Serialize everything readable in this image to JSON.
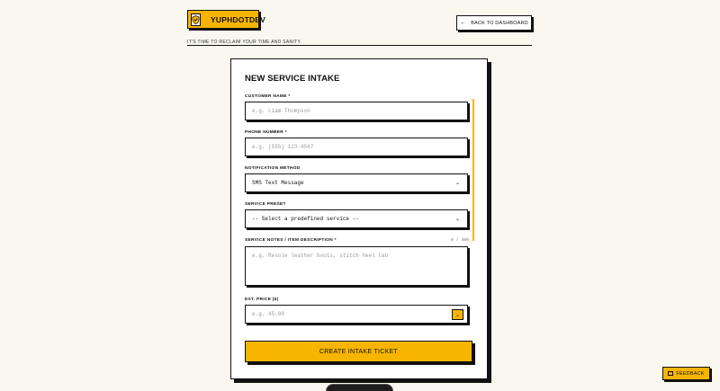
{
  "header": {
    "brand_name": "YUPHDOTDEV",
    "tagline": "IT'S TIME TO RECLAIM YOUR TIME AND SANITY.",
    "back_button": "BACK TO DASHBOARD"
  },
  "form": {
    "title": "NEW SERVICE INTAKE",
    "customer_name": {
      "label": "CUSTOMER NAME *",
      "placeholder": "e.g. Liam Thompson"
    },
    "phone": {
      "label": "PHONE NUMBER *",
      "placeholder": "e.g. (555) 123-4567"
    },
    "notification": {
      "label": "NOTIFICATION METHOD",
      "value": "SMS Text Message"
    },
    "preset": {
      "label": "SERVICE PRESET",
      "value": "-- Select a predefined service --"
    },
    "notes": {
      "label": "SERVICE NOTES / ITEM DESCRIPTION *",
      "counter": "0 / 300",
      "placeholder": "e.g. Resole leather boots, stitch heel tab"
    },
    "price": {
      "label": "EST. PRICE ($)",
      "placeholder": "e.g. 45.00"
    },
    "submit_label": "CREATE INTAKE TICKET"
  },
  "feedback_label": "FEEDBACK",
  "colors": {
    "accent": "#f7b500",
    "background": "#faf7ef",
    "ink": "#111111"
  }
}
